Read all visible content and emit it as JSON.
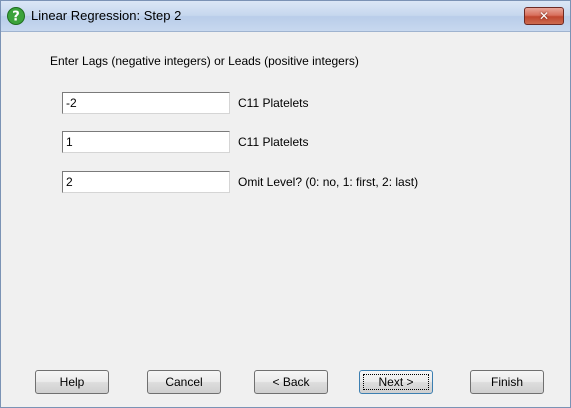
{
  "window": {
    "title": "Linear Regression: Step 2",
    "close_label": "✕"
  },
  "instruction": "Enter Lags (negative integers) or Leads (positive integers)",
  "rows": [
    {
      "value": "-2",
      "label": "C11 Platelets"
    },
    {
      "value": "1",
      "label": "C11 Platelets"
    },
    {
      "value": "2",
      "label": "Omit Level? (0: no, 1: first, 2: last)"
    }
  ],
  "buttons": {
    "help": "Help",
    "cancel": "Cancel",
    "back": "< Back",
    "next": "Next >",
    "finish": "Finish"
  },
  "icons": {
    "app": "help-circle-icon",
    "close": "close-icon"
  },
  "colors": {
    "app_icon": "#3ba33b",
    "close_button": "#c94f3a"
  }
}
